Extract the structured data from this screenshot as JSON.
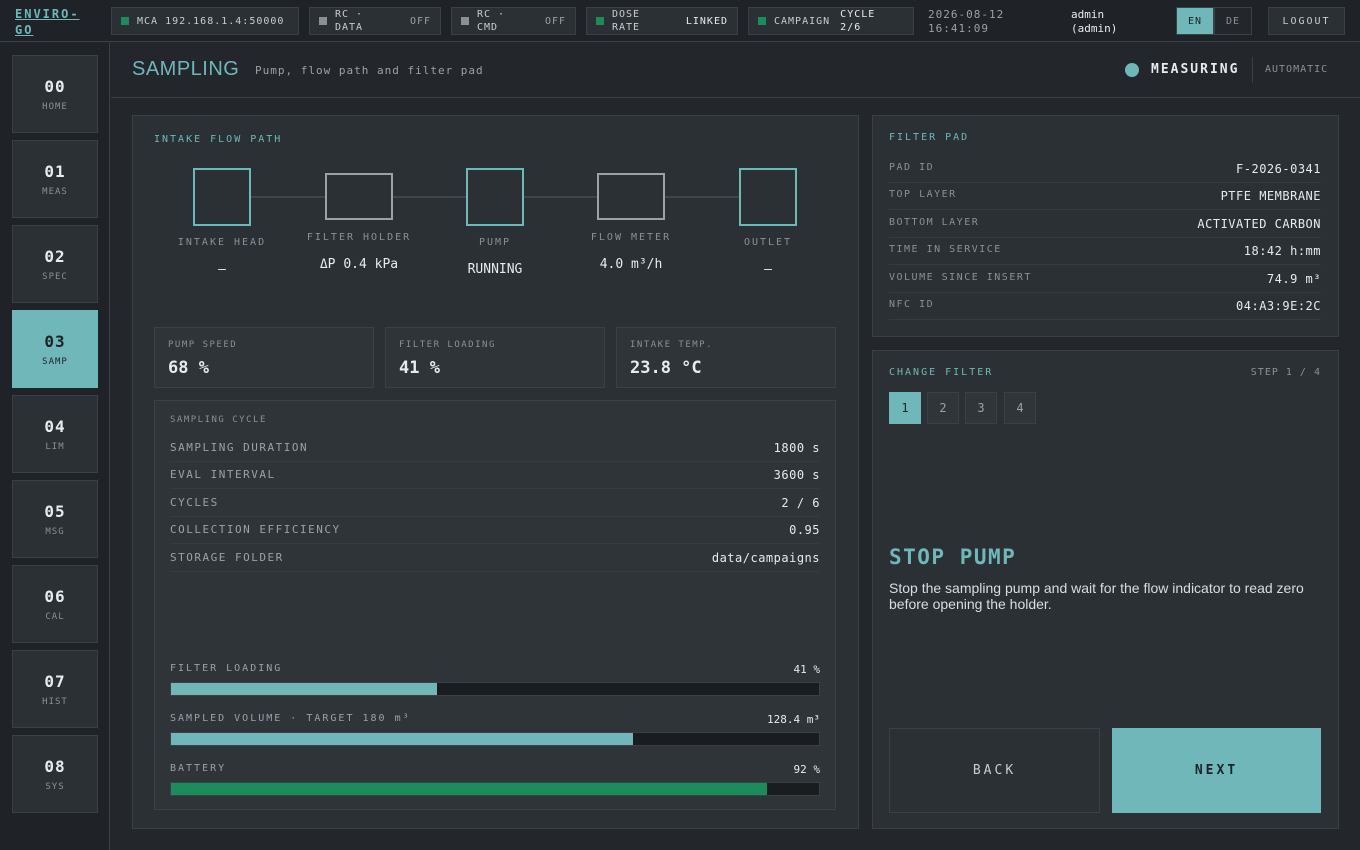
{
  "app": {
    "logo": "ENVIRO-GO"
  },
  "topbar": {
    "chips": [
      {
        "label": "MCA 192.168.1.4:50000",
        "value": "",
        "led": "green"
      },
      {
        "label": "RC · DATA",
        "value": "OFF",
        "led": "grey"
      },
      {
        "label": "RC · CMD",
        "value": "OFF",
        "led": "grey"
      },
      {
        "label": "DOSE RATE",
        "value": "LINKED",
        "led": "green"
      },
      {
        "label": "CAMPAIGN",
        "value": "CYCLE 2/6",
        "led": "green"
      }
    ],
    "date": "2026-08-12",
    "time": "16:41:09",
    "user": "admin",
    "user_role": "(admin)",
    "lang_en": "EN",
    "lang_de": "DE",
    "logout": "LOGOUT"
  },
  "sidebar": {
    "items": [
      {
        "num": "00",
        "name": "HOME"
      },
      {
        "num": "01",
        "name": "MEAS"
      },
      {
        "num": "02",
        "name": "SPEC"
      },
      {
        "num": "03",
        "name": "SAMP"
      },
      {
        "num": "04",
        "name": "LIM"
      },
      {
        "num": "05",
        "name": "MSG"
      },
      {
        "num": "06",
        "name": "CAL"
      },
      {
        "num": "07",
        "name": "HIST"
      },
      {
        "num": "08",
        "name": "SYS"
      }
    ],
    "active_index": 3
  },
  "header": {
    "title": "SAMPLING",
    "subtitle": "Pump, flow path and filter pad",
    "status": "MEASURING",
    "mode": "AUTOMATIC"
  },
  "flow": {
    "title": "INTAKE FLOW PATH",
    "nodes": [
      {
        "label": "INTAKE HEAD",
        "value": "—"
      },
      {
        "label": "FILTER HOLDER",
        "value": "ΔP 0.4 kPa"
      },
      {
        "label": "PUMP",
        "value": "RUNNING"
      },
      {
        "label": "FLOW METER",
        "value": "4.0 m³/h"
      },
      {
        "label": "OUTLET",
        "value": "—"
      }
    ]
  },
  "stats": [
    {
      "label": "PUMP SPEED",
      "value": "68 %"
    },
    {
      "label": "FILTER LOADING",
      "value": "41 %"
    },
    {
      "label": "INTAKE TEMP.",
      "value": "23.8 °C"
    }
  ],
  "cycle": {
    "title": "SAMPLING CYCLE",
    "rows": [
      {
        "key": "SAMPLING DURATION",
        "value": "1800 s"
      },
      {
        "key": "EVAL INTERVAL",
        "value": "3600 s"
      },
      {
        "key": "CYCLES",
        "value": "2 / 6"
      },
      {
        "key": "COLLECTION EFFICIENCY",
        "value": "0.95"
      },
      {
        "key": "STORAGE FOLDER",
        "value": "data/campaigns"
      }
    ]
  },
  "bars": [
    {
      "label": "FILTER LOADING",
      "value": "41 %",
      "fraction": 0.41,
      "color": "#6fb7b9"
    },
    {
      "label": "SAMPLED VOLUME · TARGET 180 m³",
      "value": "128.4 m³",
      "fraction": 0.713,
      "color": "#6fb7b9"
    },
    {
      "label": "BATTERY",
      "value": "92 %",
      "fraction": 0.92,
      "color": "#1c8c5b"
    }
  ],
  "filter_pad": {
    "title": "FILTER PAD",
    "rows": [
      {
        "key": "PAD ID",
        "value": "F-2026-0341"
      },
      {
        "key": "TOP LAYER",
        "value": "PTFE MEMBRANE"
      },
      {
        "key": "BOTTOM LAYER",
        "value": "ACTIVATED CARBON"
      },
      {
        "key": "TIME IN SERVICE",
        "value": "18:42 h:mm"
      },
      {
        "key": "VOLUME SINCE INSERT",
        "value": "74.9 m³"
      },
      {
        "key": "NFC ID",
        "value": "04:A3:9E:2C"
      }
    ]
  },
  "change_filter": {
    "title": "CHANGE FILTER",
    "step_text": "STEP 1 / 4",
    "steps": [
      "1",
      "2",
      "3",
      "4"
    ],
    "active_step": 0,
    "heading": "STOP PUMP",
    "description": "Stop the sampling pump and wait for the flow indicator to read zero before opening the holder.",
    "back": "BACK",
    "next": "NEXT"
  },
  "colors": {
    "accent": "#6fb7b9",
    "ok": "#1c8c5b",
    "background": "#23272c",
    "panel": "#2b3035"
  }
}
